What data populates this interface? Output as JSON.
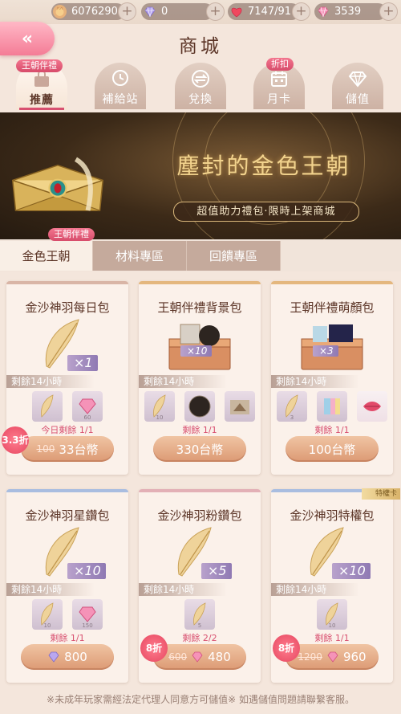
{
  "resources": [
    {
      "name": "gold",
      "value": "6076290",
      "icon": "coin-icon"
    },
    {
      "name": "diamond",
      "value": "0",
      "icon": "diamond-icon"
    },
    {
      "name": "stamina",
      "value": "7147/91",
      "icon": "heart-icon"
    },
    {
      "name": "pink_diamond",
      "value": "3539",
      "icon": "pink-diamond-icon"
    }
  ],
  "header": {
    "title": "商城"
  },
  "tabs": [
    {
      "label": "推薦",
      "tag": "王朝伴禮"
    },
    {
      "label": "補給站"
    },
    {
      "label": "兌換"
    },
    {
      "label": "月卡",
      "tag": "折扣"
    },
    {
      "label": "儲值"
    }
  ],
  "banner": {
    "title": "塵封的金色王朝",
    "subtitle": "超值助力禮包·限時上架商城"
  },
  "subtabs": [
    {
      "label": "金色王朝",
      "tag": "王朝伴禮"
    },
    {
      "label": "材料專區"
    },
    {
      "label": "回饋專區"
    }
  ],
  "cards": [
    {
      "title": "金沙神羽每日包",
      "qty": "×1",
      "remain": "剩餘14小時",
      "items": [
        {
          "count": ""
        },
        {
          "count": "60"
        }
      ],
      "note": "今日剩餘 1/1",
      "price_old": "100",
      "price": "33台幣",
      "discount": "3.3折"
    },
    {
      "title": "王朝伴禮背景包",
      "qty": "×10",
      "remain": "剩餘14小時",
      "items": [
        {
          "count": "10"
        },
        {
          "count": ""
        },
        {
          "count": ""
        }
      ],
      "note": "剩餘 1/1",
      "price": "330台幣"
    },
    {
      "title": "王朝伴禮萌顏包",
      "qty": "×3",
      "remain": "剩餘14小時",
      "items": [
        {
          "count": "3"
        },
        {
          "count": ""
        },
        {
          "count": ""
        }
      ],
      "note": "剩餘 1/1",
      "price": "100台幣"
    },
    {
      "title": "金沙神羽星鑽包",
      "qty": "×10",
      "remain": "剩餘14小時",
      "items": [
        {
          "count": "10"
        },
        {
          "count": "150"
        }
      ],
      "note": "剩餘 1/1",
      "price": "800"
    },
    {
      "title": "金沙神羽粉鑽包",
      "qty": "×5",
      "remain": "剩餘14小時",
      "items": [
        {
          "count": "5"
        }
      ],
      "note": "剩餘 2/2",
      "price_old": "600",
      "price": "480",
      "discount": "8折"
    },
    {
      "title": "金沙神羽特權包",
      "qty": "×10",
      "remain": "剩餘14小時",
      "items": [
        {
          "count": "10"
        }
      ],
      "note": "剩餘 1/1",
      "price_old": "1200",
      "price": "960",
      "discount": "8折",
      "vip_tag": "特權卡"
    }
  ],
  "footer": "※未成年玩家需經法定代理人同意方可儲值※ 如遇儲值問題請聯繫客服。"
}
